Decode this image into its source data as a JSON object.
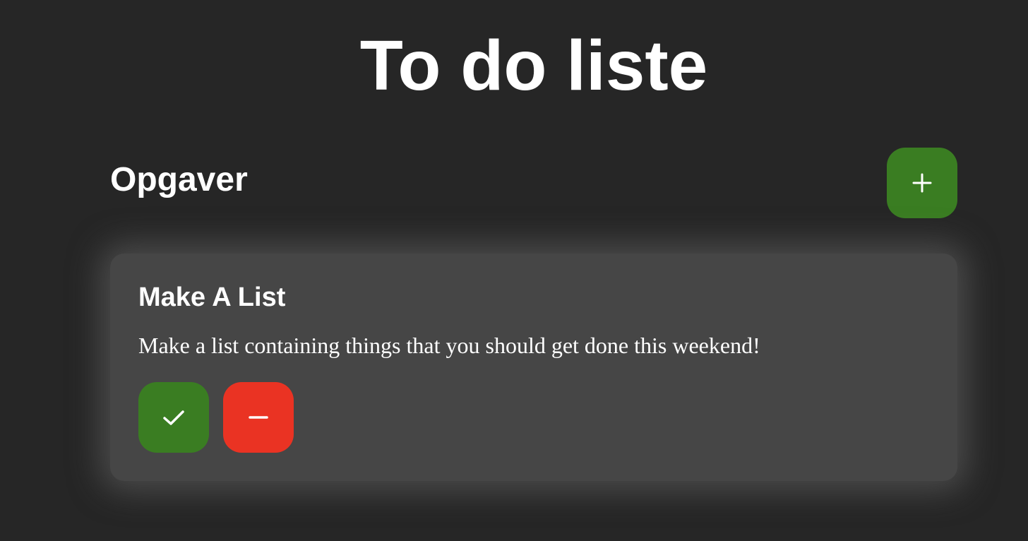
{
  "page": {
    "title": "To do liste"
  },
  "tasks_section": {
    "title": "Opgaver",
    "add_button": {
      "icon": "plus-icon",
      "color": "#3a7d22"
    }
  },
  "tasks": [
    {
      "title": "Make A List",
      "description": "Make a list containing things that you should get done this weekend!",
      "complete_button": {
        "icon": "check-icon",
        "color": "#3a7d22"
      },
      "delete_button": {
        "icon": "minus-icon",
        "color": "#ea3323"
      }
    }
  ],
  "colors": {
    "background": "#262626",
    "card": "#464646",
    "text": "#ffffff",
    "accent_green": "#3a7d22",
    "accent_red": "#ea3323"
  }
}
